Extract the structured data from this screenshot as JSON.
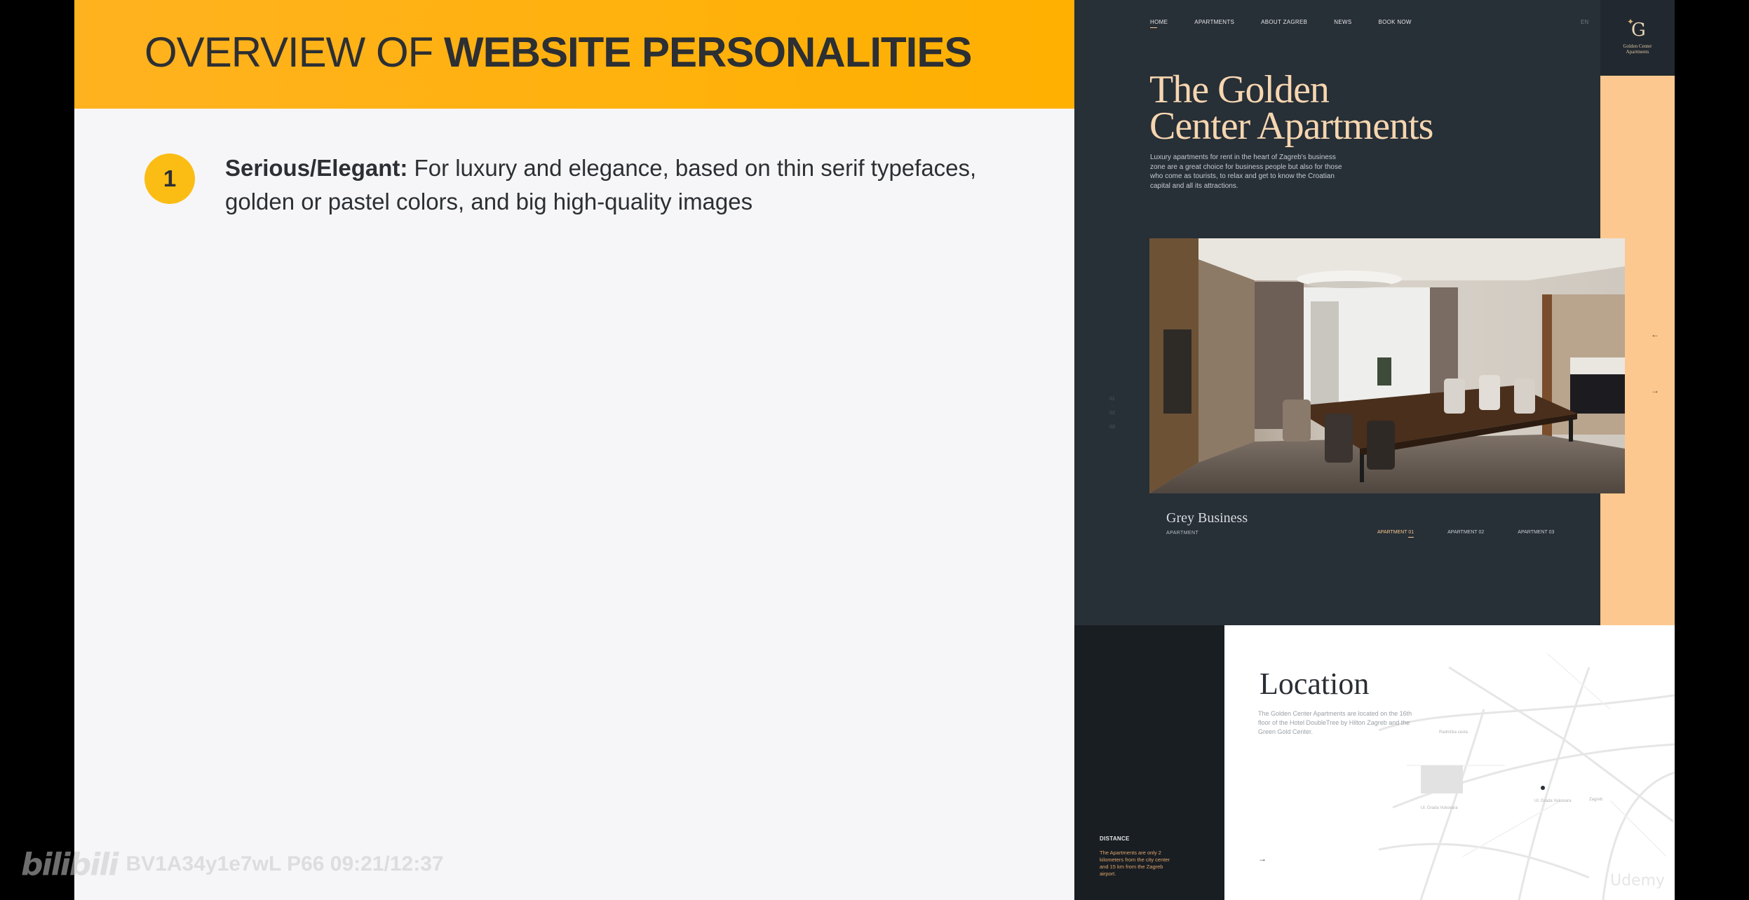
{
  "slide": {
    "title_regular": "OVERVIEW OF ",
    "title_bold": "WEBSITE PERSONALITIES",
    "points": [
      {
        "number": "1",
        "heading": "Serious/Elegant:",
        "text": " For luxury and elegance, based on thin serif typefaces, golden or pastel colors, and big high-quality images"
      }
    ]
  },
  "watermark": {
    "logo": "bilibili",
    "text": "BV1A34y1e7wL P66 09:21/12:37"
  },
  "site": {
    "nav": [
      "HOME",
      "APARTMENTS",
      "ABOUT ZAGREB",
      "NEWS",
      "BOOK NOW"
    ],
    "lang": "EN",
    "logo_letter": "G",
    "logo_name_line1": "Golden Center",
    "logo_name_line2": "Apartments",
    "hero_title_line1": "The Golden",
    "hero_title_line2": "Center Apartments",
    "hero_desc": "Luxury apartments for rent in the heart of Zagreb's business zone are a great choice for business people but also for those who come as tourists, to relax and get to know the Croatian capital and all its attractions.",
    "side_dots": "01 · 02 · 03",
    "apartment_name": "Grey Business",
    "apartment_sub": "APARTMENT",
    "apartment_tabs": [
      "APARTMENT 01",
      "APARTMENT 02",
      "APARTMENT 03"
    ],
    "location_title": "Location",
    "location_text": "The Golden Center Apartments are located on the 16th floor of the Hotel DoubleTree by Hilton Zagreb and the Green Gold Center.",
    "distance_label": "DISTANCE",
    "distance_text": "The Apartments are only 2 kilometers from the city center and 15 km from the Zagreb airport.",
    "map_labels": [
      "Radnička cesta",
      "Ul. Grada Vukovara",
      "Ul. Grada Vukovara",
      "Zagreb"
    ],
    "colors": {
      "peach": "#fdc88f",
      "dark": "#272f37",
      "gold_text": "#f6d6b0"
    }
  },
  "udemy": "Udemy"
}
